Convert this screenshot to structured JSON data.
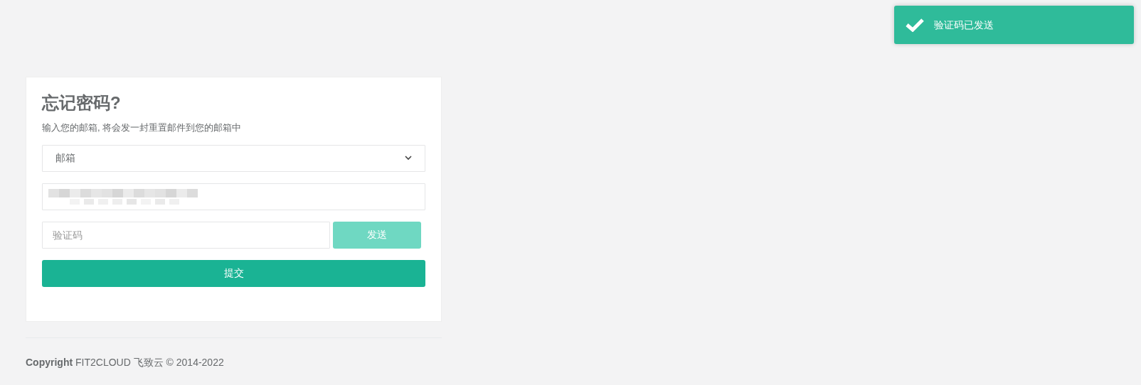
{
  "toast": {
    "message": "验证码已发送",
    "kind": "success"
  },
  "form": {
    "title": "忘记密码?",
    "subtitle": "输入您的邮箱, 将会发一封重置邮件到您的邮箱中",
    "method_select": {
      "value": "邮箱"
    },
    "email_field": {
      "blurred": true
    },
    "code_field": {
      "placeholder": "验证码"
    },
    "send_button": {
      "label": "发送",
      "disabled": true
    },
    "submit_button": {
      "label": "提交"
    }
  },
  "footer": {
    "copyright_label": "Copyright",
    "copyright_text": "FIT2CLOUD 飞致云 © 2014-2022"
  }
}
